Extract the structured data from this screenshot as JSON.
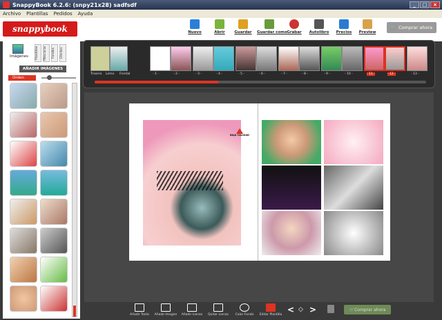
{
  "window": {
    "title": "SnappyBook 6.2.6: (snpy21x28) sadfsdf"
  },
  "menu": [
    "Archivo",
    "Plantillas",
    "Pedidos",
    "Ayuda"
  ],
  "logo": "snappybook",
  "toolbar": [
    {
      "label": "Nuevo",
      "color": "#2b7fd6"
    },
    {
      "label": "Abrir",
      "color": "#7bb43a"
    },
    {
      "label": "Guardar",
      "color": "#e0a020"
    },
    {
      "label": "Guardar como",
      "color": "#6a9a3a"
    },
    {
      "label": "Grabar",
      "color": "#c33"
    },
    {
      "label": "Autolibro",
      "color": "#555"
    },
    {
      "label": "Precios",
      "color": "#2a7bd0"
    },
    {
      "label": "Preview",
      "color": "#d9a24a"
    }
  ],
  "buy_label": "Comprar ahora",
  "left_panel": {
    "tab_images": "Imágenes",
    "vtabs": [
      "Plantillas",
      "Máscaras",
      "Fondos",
      "Efectos"
    ],
    "add_images": "AÑADIR IMÁGENES",
    "sort_label": "Orden"
  },
  "filmstrip": {
    "pages": [
      {
        "label": "Trasera"
      },
      {
        "label": "Lomo"
      },
      {
        "label": "Frontal"
      },
      {
        "label": "- 1 -"
      },
      {
        "label": "- 2 -"
      },
      {
        "label": "- 3 -"
      },
      {
        "label": "- 4 -"
      },
      {
        "label": "- 5 -"
      },
      {
        "label": "- 6 -"
      },
      {
        "label": "- 7 -"
      },
      {
        "label": "- 8 -"
      },
      {
        "label": "- 9 -"
      },
      {
        "label": "- 10 -"
      },
      {
        "label": "- 11 -"
      },
      {
        "label": "- 12 -"
      },
      {
        "label": "- 13 -"
      }
    ]
  },
  "page_tag": "BAJA CALIDAD",
  "bottom_tools": [
    "Añadir Texto",
    "Añade Imagen",
    "Añadir Lienzo",
    "Quitar Lienzo",
    "Color Fondo",
    "Editar Plantilla"
  ],
  "bottom_buy": "Comprar ahora"
}
